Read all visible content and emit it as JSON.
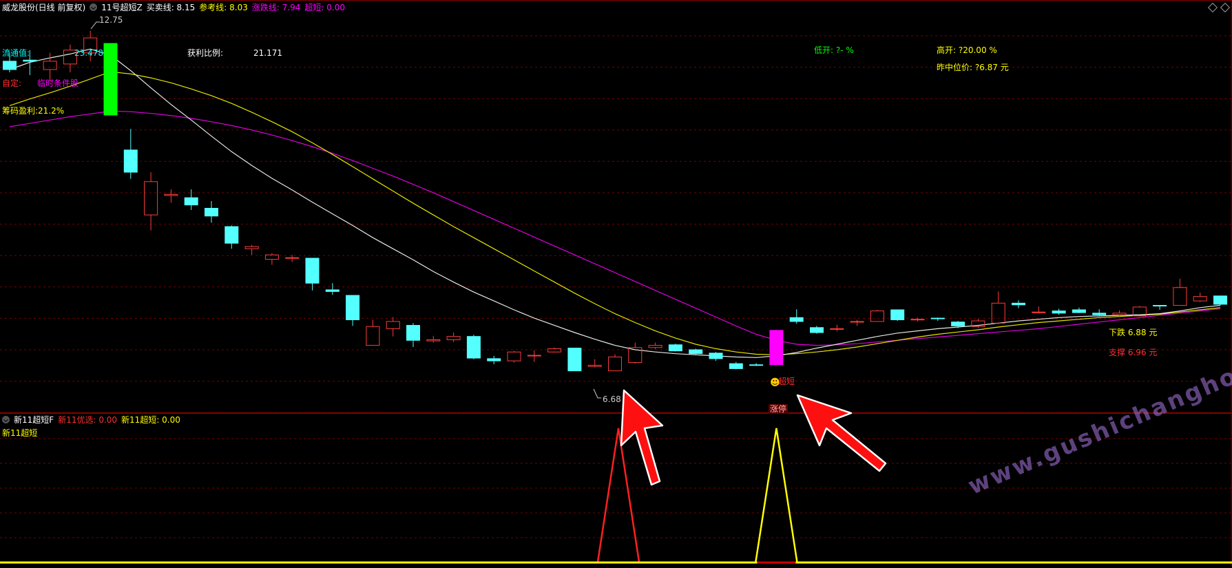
{
  "main_header": {
    "stock_name": "威龙股份(日线 前复权)",
    "indicator": "11号超短Z",
    "items": [
      {
        "label": "买卖线: 8.15",
        "color": "#ffffff"
      },
      {
        "label": "参考线: 8.03",
        "color": "#ffff00"
      },
      {
        "label": "涨跌线: 7.94",
        "color": "#ff00ff"
      },
      {
        "label": "超短: 0.00",
        "color": "#ff00ff"
      }
    ]
  },
  "info_labels": {
    "liutong": "流通值: ",
    "liutong_value": "23.478",
    "ziding": "自定:",
    "linshi": "临时条件股",
    "chouma": "筹码盈利:21.2%",
    "huoli_label": "获利比例:",
    "huoli_value": "21.171",
    "dikai": "低开: ?- %",
    "gaokai": "高开: ?20.00 %",
    "zuozhong": "昨中位价: ?6.87 元",
    "xiadie": "下跌 6.88 元",
    "zhicheng": "支撑 6.96 元",
    "high_marker": "12.75",
    "low_marker": "6.68",
    "chaoduan_mark": "超短",
    "zhangting_mark": "涨停"
  },
  "sub_header": {
    "indicator": "新11超短F",
    "items": [
      {
        "label": "新11优选: 0.00",
        "color": "#ff3030"
      },
      {
        "label": "新11超短: 0.00",
        "color": "#ffff00"
      }
    ],
    "sub_label": "新11超短"
  },
  "watermark": "www.gushichanghong.com",
  "colors": {
    "up": "#ff3c3c",
    "down": "#54ffff",
    "ma_white": "#e8e8e8",
    "ma_yellow": "#e6e600",
    "ma_magenta": "#e000e0",
    "grid": "#7a0000",
    "special_green": "#00ff00",
    "special_magenta": "#ff00ff"
  },
  "chart_data": [
    {
      "type": "candlestick",
      "title": "威龙股份(日线 前复权)",
      "ylim": [
        6.2,
        13.2
      ],
      "candles": [
        {
          "o": 12.2,
          "h": 12.35,
          "l": 12.0,
          "c": 12.05
        },
        {
          "o": 12.22,
          "h": 12.4,
          "l": 11.95,
          "c": 12.2
        },
        {
          "o": 12.05,
          "h": 12.35,
          "l": 11.85,
          "c": 12.2
        },
        {
          "o": 12.15,
          "h": 12.5,
          "l": 12.0,
          "c": 12.4
        },
        {
          "o": 12.35,
          "h": 12.75,
          "l": 12.2,
          "c": 12.62
        },
        {
          "o": 12.52,
          "h": 12.52,
          "l": 11.23,
          "c": 11.23,
          "special": "green"
        },
        {
          "o": 10.6,
          "h": 10.98,
          "l": 10.08,
          "c": 10.2
        },
        {
          "o": 9.43,
          "h": 10.2,
          "l": 9.15,
          "c": 10.03
        },
        {
          "o": 9.78,
          "h": 9.89,
          "l": 9.65,
          "c": 9.8
        },
        {
          "o": 9.74,
          "h": 9.89,
          "l": 9.52,
          "c": 9.61
        },
        {
          "o": 9.55,
          "h": 9.68,
          "l": 9.29,
          "c": 9.41
        },
        {
          "o": 9.22,
          "h": 9.24,
          "l": 8.82,
          "c": 8.92
        },
        {
          "o": 8.82,
          "h": 8.89,
          "l": 8.71,
          "c": 8.86
        },
        {
          "o": 8.63,
          "h": 8.74,
          "l": 8.53,
          "c": 8.71
        },
        {
          "o": 8.65,
          "h": 8.71,
          "l": 8.58,
          "c": 8.66
        },
        {
          "o": 8.65,
          "h": 8.65,
          "l": 8.07,
          "c": 8.2
        },
        {
          "o": 8.08,
          "h": 8.2,
          "l": 7.99,
          "c": 8.05
        },
        {
          "o": 7.98,
          "h": 7.98,
          "l": 7.43,
          "c": 7.54
        },
        {
          "o": 7.08,
          "h": 7.54,
          "l": 7.08,
          "c": 7.42
        },
        {
          "o": 7.38,
          "h": 7.59,
          "l": 7.24,
          "c": 7.51
        },
        {
          "o": 7.44,
          "h": 7.48,
          "l": 7.05,
          "c": 7.17
        },
        {
          "o": 7.16,
          "h": 7.25,
          "l": 7.13,
          "c": 7.18
        },
        {
          "o": 7.18,
          "h": 7.31,
          "l": 7.14,
          "c": 7.24
        },
        {
          "o": 7.24,
          "h": 7.27,
          "l": 6.83,
          "c": 6.85
        },
        {
          "o": 6.84,
          "h": 6.89,
          "l": 6.74,
          "c": 6.8
        },
        {
          "o": 6.8,
          "h": 6.98,
          "l": 6.77,
          "c": 6.96
        },
        {
          "o": 6.9,
          "h": 6.99,
          "l": 6.78,
          "c": 6.9
        },
        {
          "o": 6.96,
          "h": 7.04,
          "l": 6.95,
          "c": 7.02
        },
        {
          "o": 7.03,
          "h": 7.03,
          "l": 6.62,
          "c": 6.62
        },
        {
          "o": 6.7,
          "h": 6.83,
          "l": 6.68,
          "c": 6.72
        },
        {
          "o": 6.62,
          "h": 6.92,
          "l": 6.62,
          "c": 6.87
        },
        {
          "o": 6.77,
          "h": 7.13,
          "l": 6.75,
          "c": 7.04
        },
        {
          "o": 7.04,
          "h": 7.13,
          "l": 7.01,
          "c": 7.08
        },
        {
          "o": 7.09,
          "h": 7.11,
          "l": 6.97,
          "c": 6.98
        },
        {
          "o": 7.0,
          "h": 7.02,
          "l": 6.92,
          "c": 6.93
        },
        {
          "o": 6.94,
          "h": 6.96,
          "l": 6.8,
          "c": 6.84
        },
        {
          "o": 6.75,
          "h": 6.78,
          "l": 6.65,
          "c": 6.66
        },
        {
          "o": 6.73,
          "h": 6.76,
          "l": 6.71,
          "c": 6.72
        },
        {
          "o": 6.73,
          "h": 7.35,
          "l": 6.73,
          "c": 7.35,
          "special": "magenta"
        },
        {
          "o": 7.58,
          "h": 7.73,
          "l": 7.47,
          "c": 7.51
        },
        {
          "o": 7.4,
          "h": 7.43,
          "l": 7.29,
          "c": 7.31
        },
        {
          "o": 7.37,
          "h": 7.45,
          "l": 7.33,
          "c": 7.38
        },
        {
          "o": 7.51,
          "h": 7.54,
          "l": 7.43,
          "c": 7.51
        },
        {
          "o": 7.51,
          "h": 7.72,
          "l": 7.51,
          "c": 7.7
        },
        {
          "o": 7.72,
          "h": 7.72,
          "l": 7.52,
          "c": 7.54
        },
        {
          "o": 7.55,
          "h": 7.58,
          "l": 7.51,
          "c": 7.55
        },
        {
          "o": 7.57,
          "h": 7.58,
          "l": 7.52,
          "c": 7.56
        },
        {
          "o": 7.5,
          "h": 7.52,
          "l": 7.39,
          "c": 7.43
        },
        {
          "o": 7.42,
          "h": 7.56,
          "l": 7.39,
          "c": 7.52
        },
        {
          "o": 7.48,
          "h": 8.05,
          "l": 7.46,
          "c": 7.84
        },
        {
          "o": 7.84,
          "h": 7.89,
          "l": 7.75,
          "c": 7.81
        },
        {
          "o": 7.67,
          "h": 7.78,
          "l": 7.65,
          "c": 7.68
        },
        {
          "o": 7.7,
          "h": 7.74,
          "l": 7.63,
          "c": 7.66
        },
        {
          "o": 7.72,
          "h": 7.76,
          "l": 7.66,
          "c": 7.67
        },
        {
          "o": 7.66,
          "h": 7.73,
          "l": 7.6,
          "c": 7.63
        },
        {
          "o": 7.63,
          "h": 7.71,
          "l": 7.6,
          "c": 7.66
        },
        {
          "o": 7.61,
          "h": 7.79,
          "l": 7.6,
          "c": 7.77
        },
        {
          "o": 7.8,
          "h": 7.8,
          "l": 7.72,
          "c": 7.79
        },
        {
          "o": 7.8,
          "h": 8.28,
          "l": 7.8,
          "c": 8.12
        },
        {
          "o": 7.88,
          "h": 8.03,
          "l": 7.86,
          "c": 7.96
        },
        {
          "o": 7.97,
          "h": 7.97,
          "l": 7.8,
          "c": 7.82
        }
      ],
      "ma_white": [
        12.05,
        12.18,
        12.26,
        12.33,
        12.42,
        12.31,
        12.03,
        11.72,
        11.42,
        11.14,
        10.85,
        10.57,
        10.32,
        10.09,
        9.88,
        9.66,
        9.45,
        9.24,
        9.02,
        8.82,
        8.62,
        8.41,
        8.22,
        8.04,
        7.88,
        7.72,
        7.57,
        7.44,
        7.31,
        7.19,
        7.08,
        7.0,
        6.96,
        6.93,
        6.91,
        6.89,
        6.87,
        6.86,
        6.89,
        6.95,
        7.03,
        7.1,
        7.17,
        7.24,
        7.3,
        7.34,
        7.38,
        7.41,
        7.44,
        7.48,
        7.52,
        7.55,
        7.58,
        7.6,
        7.61,
        7.62,
        7.63,
        7.65,
        7.7,
        7.76,
        7.8
      ],
      "ma_yellow": [
        11.4,
        11.52,
        11.63,
        11.75,
        11.88,
        12.01,
        11.97,
        11.9,
        11.81,
        11.7,
        11.58,
        11.44,
        11.28,
        11.11,
        10.93,
        10.73,
        10.52,
        10.3,
        10.08,
        9.86,
        9.64,
        9.43,
        9.22,
        9.02,
        8.82,
        8.62,
        8.42,
        8.22,
        8.02,
        7.83,
        7.65,
        7.49,
        7.34,
        7.21,
        7.1,
        7.02,
        6.96,
        6.92,
        6.91,
        6.93,
        6.96,
        7.0,
        7.05,
        7.11,
        7.17,
        7.23,
        7.28,
        7.32,
        7.36,
        7.41,
        7.45,
        7.49,
        7.52,
        7.55,
        7.58,
        7.6,
        7.62,
        7.64,
        7.68,
        7.72,
        7.76
      ],
      "ma_magenta": [
        11.02,
        11.08,
        11.14,
        11.2,
        11.25,
        11.3,
        11.29,
        11.26,
        11.22,
        11.17,
        11.11,
        11.04,
        10.96,
        10.87,
        10.77,
        10.66,
        10.54,
        10.41,
        10.27,
        10.13,
        9.98,
        9.83,
        9.67,
        9.51,
        9.35,
        9.19,
        9.03,
        8.87,
        8.71,
        8.55,
        8.39,
        8.23,
        8.07,
        7.91,
        7.75,
        7.59,
        7.43,
        7.28,
        7.17,
        7.1,
        7.08,
        7.09,
        7.11,
        7.14,
        7.17,
        7.2,
        7.23,
        7.26,
        7.29,
        7.32,
        7.35,
        7.38,
        7.42,
        7.46,
        7.5,
        7.54,
        7.58,
        7.62,
        7.66,
        7.7,
        7.74
      ]
    },
    {
      "type": "line",
      "title": "新11超短F",
      "ylim": [
        0,
        1
      ],
      "series": [
        {
          "name": "新11优选",
          "color": "#ff2020",
          "peak_index": 30,
          "value": 1
        },
        {
          "name": "新11超短",
          "color": "#ffff00",
          "peak_index": 38,
          "value": 1
        }
      ]
    }
  ]
}
